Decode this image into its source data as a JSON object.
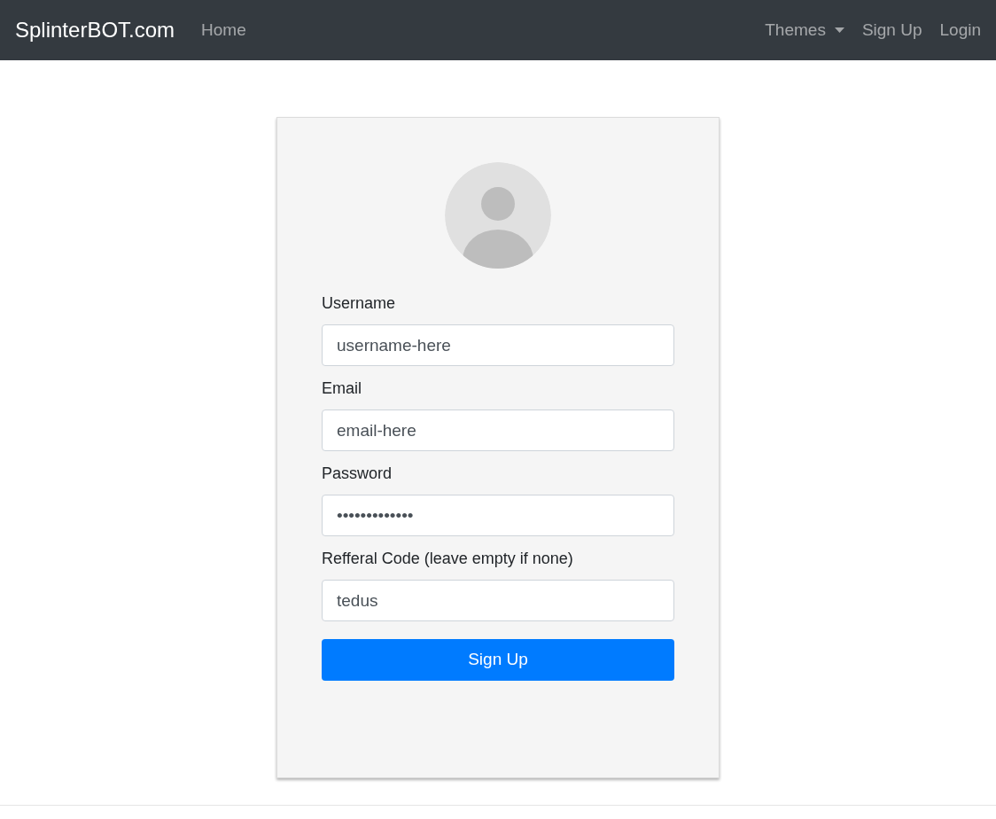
{
  "navbar": {
    "brand": "SplinterBOT.com",
    "left_links": [
      {
        "label": "Home"
      }
    ],
    "right_links": [
      {
        "label": "Themes",
        "kind": "dropdown"
      },
      {
        "label": "Sign Up",
        "kind": "link"
      },
      {
        "label": "Login",
        "kind": "link"
      }
    ]
  },
  "form": {
    "fields": [
      {
        "label": "Username",
        "value": "username-here"
      },
      {
        "label": "Email",
        "value": "email-here"
      },
      {
        "label": "Password",
        "value": "•••••••••••••"
      },
      {
        "label": "Refferal Code (leave empty if none)",
        "value": "tedus"
      }
    ],
    "submit": "Sign Up"
  }
}
